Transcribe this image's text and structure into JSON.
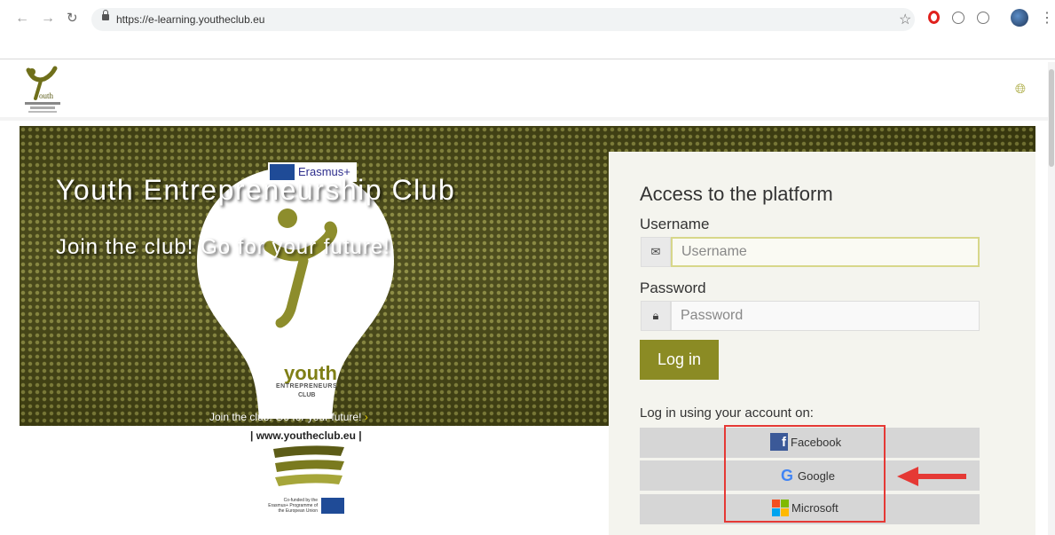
{
  "browser": {
    "url": "https://e-learning.youtheclub.eu",
    "back_icon": "arrow-left-icon",
    "forward_icon": "arrow-right-icon",
    "reload_icon": "reload-icon",
    "bookmark_icon": "star-icon",
    "extensions": [
      "opera-icon",
      "block-icon",
      "circle-icon",
      "profile-avatar"
    ],
    "menu_icon": "kebab-menu-icon"
  },
  "site": {
    "logo": "youth-club-logo",
    "language_icon": "globe-icon"
  },
  "hero": {
    "title": "Youth Entrepreneurship Club",
    "subtitle": "Join the club! Go for your future!",
    "erasmus_label": "Erasmus+",
    "bulb_youth": "youth",
    "bulb_entrepreneurs": "ENTREPRENEURS",
    "bulb_club": "CLUB",
    "tagline": "Join the club. Go for your future!",
    "website": "| www.youtheclub.eu |",
    "eu_funding": "Co-funded by the Erasmus+ Programme of the European Union",
    "colors": {
      "background": "#44440f",
      "accent": "#8b8b24"
    }
  },
  "login": {
    "title": "Access to the platform",
    "username_label": "Username",
    "username_placeholder": "Username",
    "username_value": "",
    "password_label": "Password",
    "password_placeholder": "Password",
    "password_value": "",
    "submit_label": "Log in",
    "alt_label": "Log in using your account on:",
    "providers": [
      {
        "name": "Facebook",
        "icon": "facebook-icon"
      },
      {
        "name": "Google",
        "icon": "google-icon"
      },
      {
        "name": "Microsoft",
        "icon": "microsoft-icon"
      }
    ]
  },
  "annotation": {
    "highlight_color": "#e53935",
    "arrow_target": "Google"
  }
}
